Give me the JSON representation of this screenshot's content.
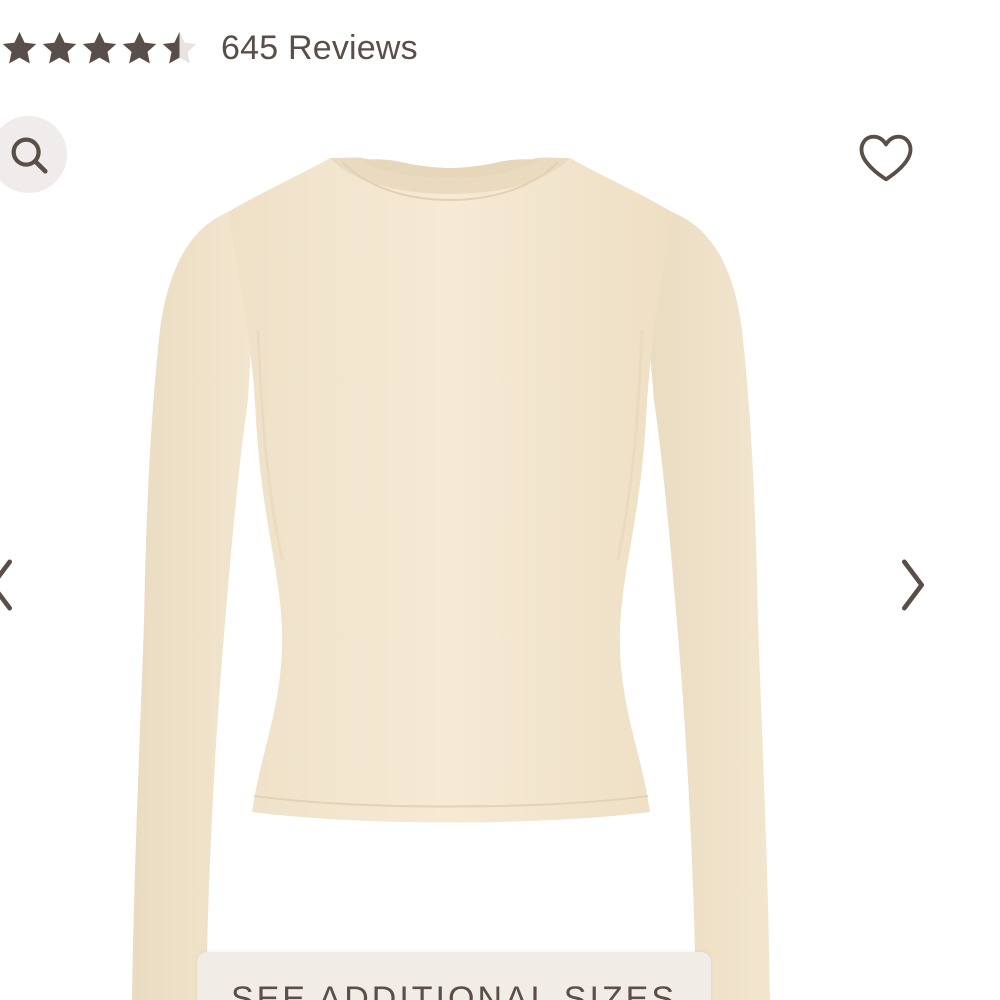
{
  "rating": {
    "value": 4.5,
    "max": 5,
    "reviews_label": "645 Reviews",
    "star_color": "#5a4f48",
    "star_empty_color": "#e6e3e1"
  },
  "toolbar": {
    "zoom_icon": "search-icon",
    "wishlist_icon": "heart-icon"
  },
  "gallery": {
    "prev_icon": "chevron-left-icon",
    "next_icon": "chevron-right-icon",
    "product_image": "cream long-sleeve crew neck top"
  },
  "sizes_button": {
    "label": "SEE ADDITIONAL SIZES"
  },
  "colors": {
    "text": "#5a4f48",
    "garment": "#f3e7d1",
    "button_bg": "#f1ece6"
  }
}
